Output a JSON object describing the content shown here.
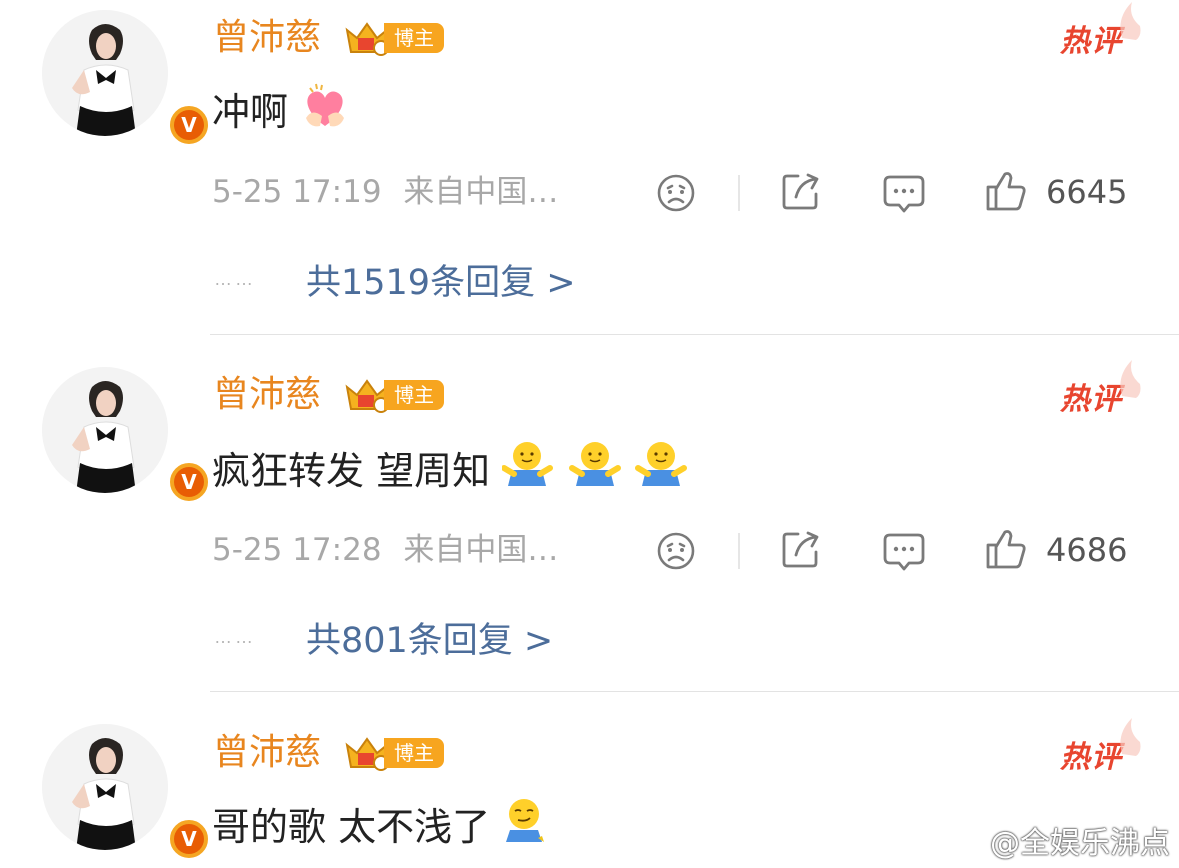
{
  "comments": [
    {
      "username": "曾沛慈",
      "badge_label": "博主",
      "hot_label": "热评",
      "text": "冲啊",
      "emoji": "heart-hands",
      "timestamp": "5-25 17:19",
      "source": "来自中国…",
      "likes": "6645",
      "replies_dots": "……",
      "replies_label": "共1519条回复 >"
    },
    {
      "username": "曾沛慈",
      "badge_label": "博主",
      "hot_label": "热评",
      "text": "疯狂转发 望周知",
      "emoji": "hug-x3",
      "timestamp": "5-25 17:28",
      "source": "来自中国…",
      "likes": "4686",
      "replies_dots": "……",
      "replies_label": "共801条回复 >"
    },
    {
      "username": "曾沛慈",
      "badge_label": "博主",
      "hot_label": "热评",
      "text": "哥的歌 太不浅了",
      "emoji": "smirk-sitting"
    }
  ],
  "watermark": "@全娱乐沸点",
  "colors": {
    "username": "#e8861f",
    "badge": "#f7a51f",
    "hot": "#e8452f",
    "link": "#4c6d9a",
    "meta": "#a8a8a8"
  }
}
